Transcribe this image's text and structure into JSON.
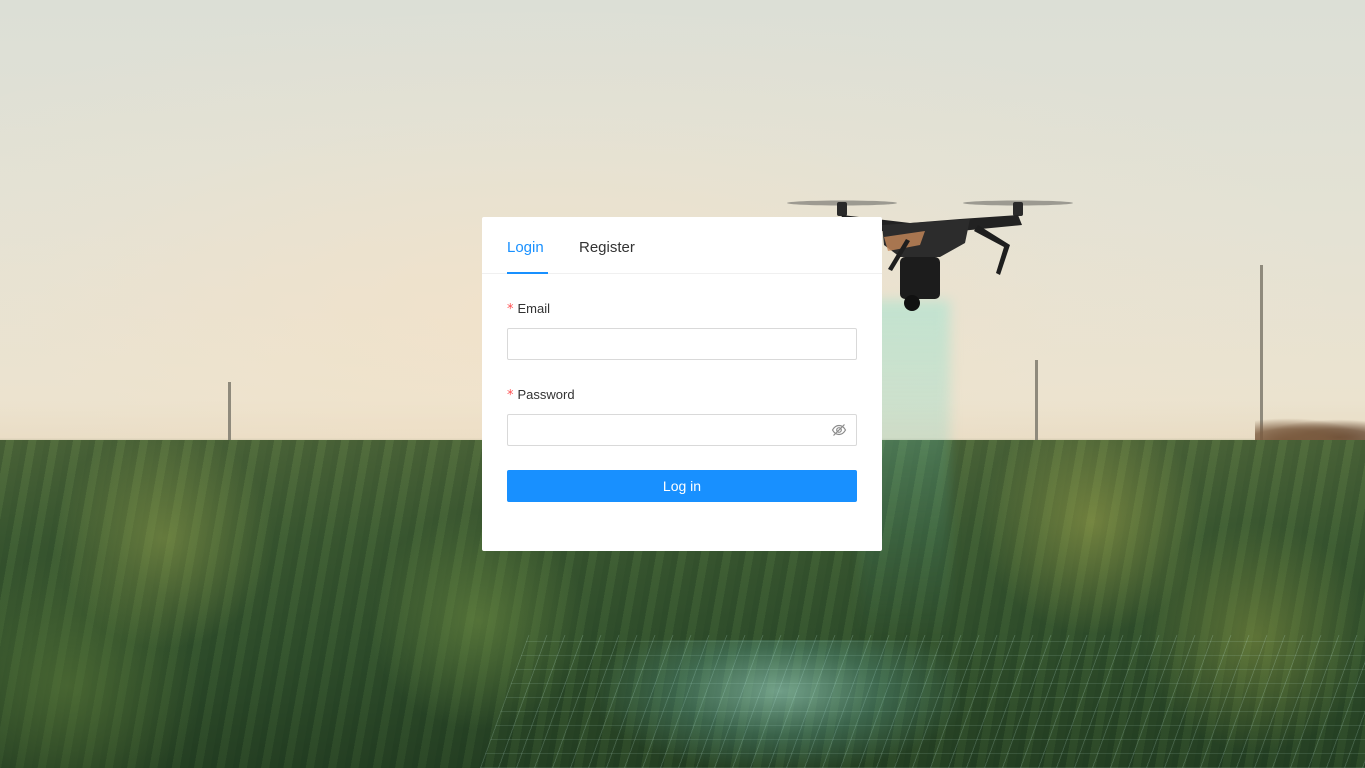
{
  "tabs": [
    {
      "label": "Login",
      "active": true
    },
    {
      "label": "Register",
      "active": false
    }
  ],
  "form": {
    "email_label": "Email",
    "email_value": "",
    "email_placeholder": "",
    "password_label": "Password",
    "password_value": "",
    "password_placeholder": "",
    "required_mark": "*",
    "submit_label": "Log in",
    "password_toggle_icon": "eye-invisible-icon"
  },
  "colors": {
    "accent": "#1890ff",
    "required": "#ff4d4f"
  },
  "background": {
    "description_icon": "drone-over-field-photo"
  }
}
